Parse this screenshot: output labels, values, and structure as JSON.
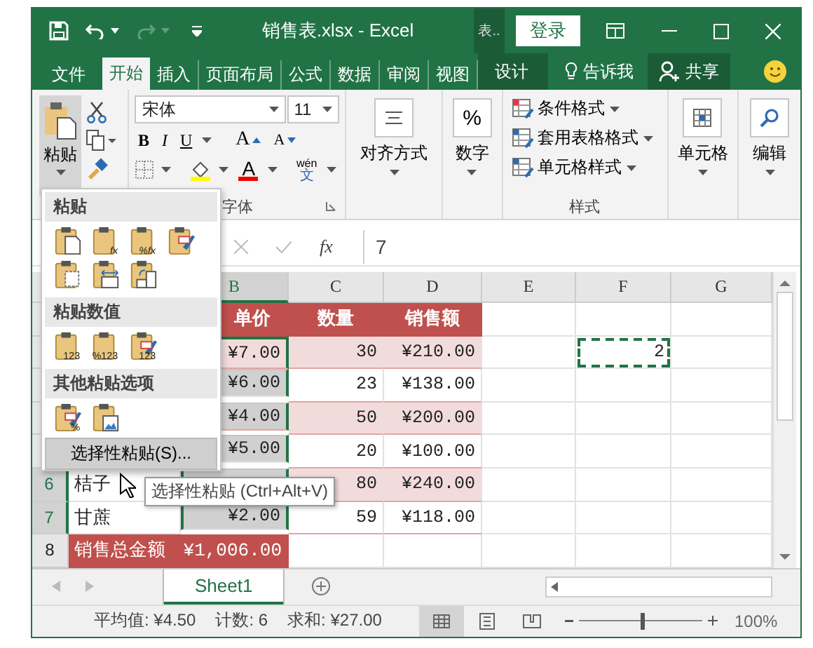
{
  "window": {
    "title": "销售表.xlsx - Excel",
    "context_tab": "表..",
    "sign_in": "登录"
  },
  "ribbon_tabs": [
    {
      "label": "文件",
      "selected": false
    },
    {
      "label": "开始",
      "selected": true
    },
    {
      "label": "插入",
      "selected": false
    },
    {
      "label": "页面布局",
      "selected": false
    },
    {
      "label": "公式",
      "selected": false
    },
    {
      "label": "数据",
      "selected": false
    },
    {
      "label": "审阅",
      "selected": false
    },
    {
      "label": "视图",
      "selected": false
    }
  ],
  "context_ribbon_tab": "设计",
  "tell_me": "告诉我",
  "share": "共享",
  "ribbon": {
    "paste": "粘贴",
    "font_name": "宋体",
    "font_size": "11",
    "bold": "B",
    "italic": "I",
    "underline": "U",
    "grow_font": "A",
    "shrink_font": "A",
    "font_color": "A",
    "phonetic": "wén",
    "phonetic_char": "文",
    "font_group": "字体",
    "alignment": "对齐方式",
    "number_symbol": "%",
    "number": "数字",
    "styles": [
      "条件格式",
      "套用表格格式",
      "单元格样式"
    ],
    "styles_group": "样式",
    "cells": "单元格",
    "editing": "编辑"
  },
  "formula_bar": {
    "function_label": "fx",
    "value": "7"
  },
  "columns": [
    {
      "label": "B",
      "selected": true
    },
    {
      "label": "C",
      "selected": false
    },
    {
      "label": "D",
      "selected": false
    },
    {
      "label": "E",
      "selected": false
    },
    {
      "label": "F",
      "selected": false
    },
    {
      "label": "G",
      "selected": false
    }
  ],
  "rows": [
    {
      "kind": "header",
      "b": {
        "text": "单价",
        "selected": false
      },
      "c": {
        "text": "数量"
      },
      "d": {
        "text": "销售额"
      }
    },
    {
      "kind": "band",
      "b": {
        "text": "¥7.00",
        "selected": true,
        "active": true
      },
      "c": {
        "text": "30"
      },
      "d": {
        "text": "¥210.00"
      },
      "f": {
        "text": "2",
        "copied": true
      }
    },
    {
      "kind": "plain",
      "b": {
        "text": "¥6.00",
        "selected": true,
        "active": false
      },
      "c": {
        "text": "23"
      },
      "d": {
        "text": "¥138.00"
      }
    },
    {
      "kind": "band",
      "b": {
        "text": "¥4.00",
        "selected": true,
        "active": false
      },
      "c": {
        "text": "50"
      },
      "d": {
        "text": "¥200.00"
      }
    },
    {
      "kind": "plain",
      "b": {
        "text": "¥5.00",
        "selected": true,
        "active": false
      },
      "c": {
        "text": "20"
      },
      "d": {
        "text": "¥100.00"
      }
    },
    {
      "kind": "band",
      "number": "6",
      "selected": true,
      "a": {
        "text": "桔子"
      },
      "b": {
        "selected": true,
        "active": false
      },
      "c": {
        "text": "80"
      },
      "d": {
        "text": "¥240.00"
      }
    },
    {
      "kind": "plain",
      "number": "7",
      "selected": true,
      "a": {
        "text": "甘蔗"
      },
      "b": {
        "text": "¥2.00",
        "selected": true,
        "active": false
      },
      "c": {
        "text": "59"
      },
      "d": {
        "text": "¥118.00"
      }
    },
    {
      "kind": "total",
      "number": "8",
      "selected": false,
      "a": {
        "text": "销售总金额"
      },
      "b": {
        "text": "¥1,006.00",
        "selected": false
      }
    }
  ],
  "paste_menu": {
    "sections": [
      {
        "title": "粘贴",
        "icons": [
          {
            "kind": "doc"
          },
          {
            "kind": "formula",
            "badge": "fx"
          },
          {
            "kind": "formula",
            "badge": "%fx"
          },
          {
            "kind": "brush"
          },
          {
            "kind": "noborder"
          },
          {
            "kind": "width"
          },
          {
            "kind": "transpose"
          }
        ]
      },
      {
        "title": "粘贴数值",
        "icons": [
          {
            "kind": "values",
            "badge": "123"
          },
          {
            "kind": "values",
            "badge": "%123"
          },
          {
            "kind": "brushvalues",
            "badge": "123"
          }
        ]
      },
      {
        "title": "其他粘贴选项",
        "icons": [
          {
            "kind": "brush",
            "badge": "%"
          },
          {
            "kind": "picture"
          }
        ]
      }
    ],
    "footer": "选择性粘贴(S)..."
  },
  "tooltip": "选择性粘贴 (Ctrl+Alt+V)",
  "sheet_tabs": [
    {
      "label": "Sheet1",
      "selected": true
    }
  ],
  "status_bar": {
    "items": [
      "平均值: ¥4.50",
      "计数: 6",
      "求和: ¥27.00"
    ],
    "view_buttons": [
      {
        "kind": "normal",
        "selected": true
      },
      {
        "kind": "page-layout",
        "selected": false
      },
      {
        "kind": "page-break",
        "selected": false
      }
    ],
    "zoom": {
      "level": 0.5,
      "reading": "100%"
    }
  }
}
